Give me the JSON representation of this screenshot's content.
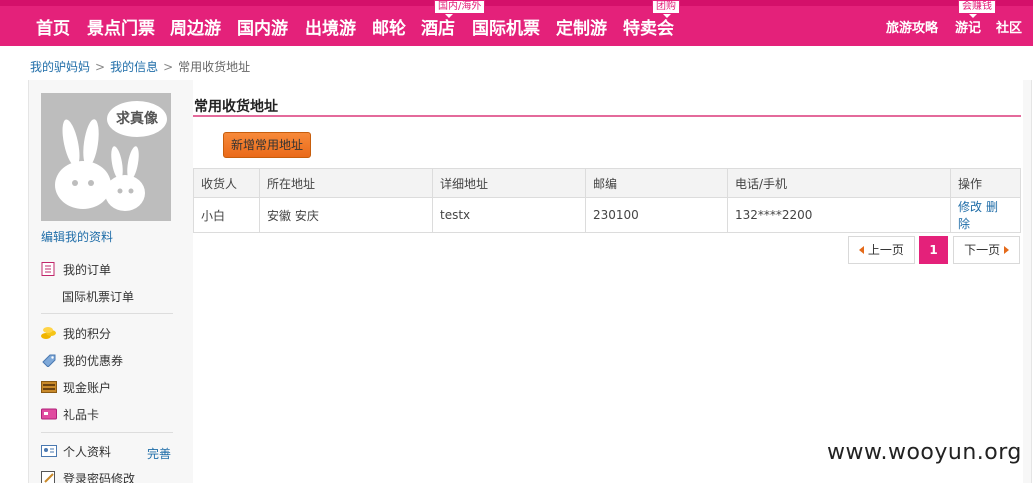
{
  "nav": {
    "main": [
      "首页",
      "景点门票",
      "周边游",
      "国内游",
      "出境游",
      "邮轮",
      "酒店",
      "国际机票",
      "定制游",
      "特卖会"
    ],
    "tags": {
      "hotel": "国内/海外",
      "sale": "团购",
      "notes": "会赚钱"
    },
    "right": [
      "旅游攻略",
      "游记",
      "社区"
    ]
  },
  "breadcrumb": {
    "home": "我的驴妈妈",
    "sep1": ">",
    "info": "我的信息",
    "sep2": ">",
    "current": "常用收货地址"
  },
  "sidebar": {
    "avatar_text": "求真像",
    "edit_profile": "编辑我的资料",
    "items": {
      "orders": "我的订单",
      "intl_orders": "国际机票订单",
      "points": "我的积分",
      "coupons": "我的优惠券",
      "cash": "现金账户",
      "giftcard": "礼品卡",
      "profile": "个人资料",
      "profile_status": "完善",
      "password": "登录密码修改"
    }
  },
  "content": {
    "title": "常用收货地址",
    "add_button": "新增常用地址",
    "table": {
      "headers": [
        "收货人",
        "所在地址",
        "详细地址",
        "邮编",
        "电话/手机",
        "操作"
      ],
      "rows": [
        {
          "name": "小白",
          "region": "安徽 安庆",
          "detail": "testx",
          "zip": "230100",
          "phone": "132****2200",
          "edit": "修改",
          "delete": "删除"
        }
      ]
    },
    "pager": {
      "prev": "上一页",
      "current": "1",
      "next": "下一页"
    }
  },
  "watermark": "www.wooyun.org",
  "colors": {
    "brand": "#e4217a",
    "link": "#1f6da8",
    "button": "#ea6a1a"
  }
}
